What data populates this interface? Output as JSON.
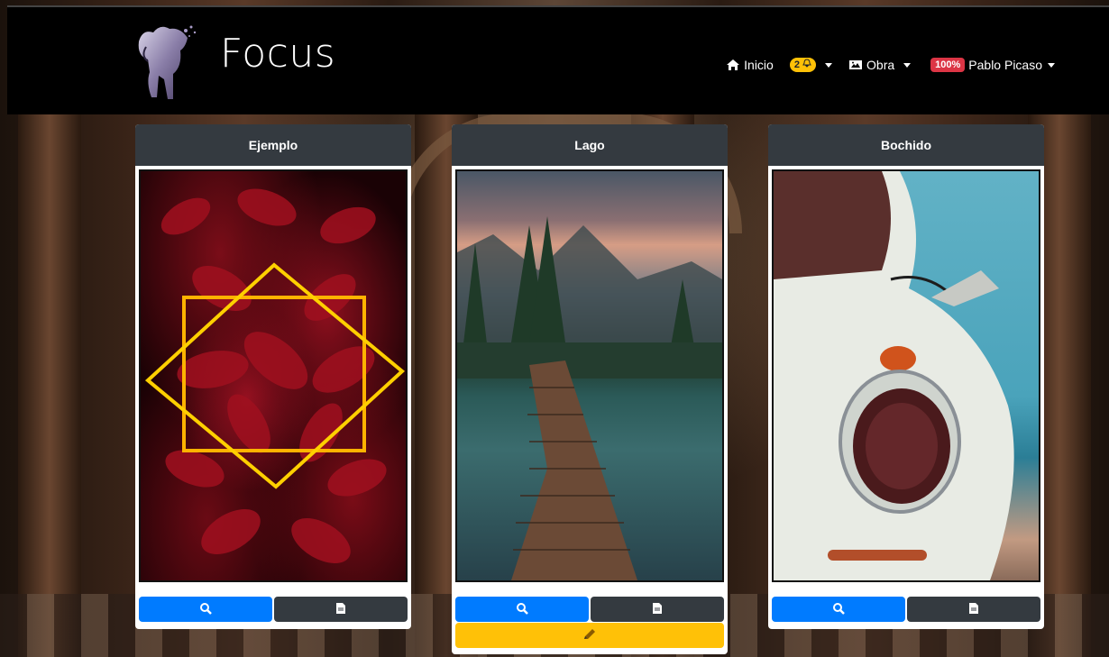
{
  "brand": {
    "title": "Focus"
  },
  "nav": {
    "home_label": "Inicio",
    "notifications_count": "2",
    "obra_label": "Obra",
    "progress_badge": "100%",
    "user_name": "Pablo Picaso"
  },
  "colors": {
    "navbar_bg": "#000000",
    "card_header_bg": "#343a40",
    "primary": "#007bff",
    "dark": "#343a40",
    "warning": "#ffc107",
    "danger": "#dc3545"
  },
  "icons": {
    "home": "home-icon",
    "bell": "bell-icon",
    "image": "image-icon",
    "search": "search-icon",
    "file": "file-icon",
    "pencil": "pencil-icon"
  },
  "cards": [
    {
      "title": "Ejemplo",
      "editable": false
    },
    {
      "title": "Lago",
      "editable": true
    },
    {
      "title": "Bochido",
      "editable": false
    }
  ]
}
